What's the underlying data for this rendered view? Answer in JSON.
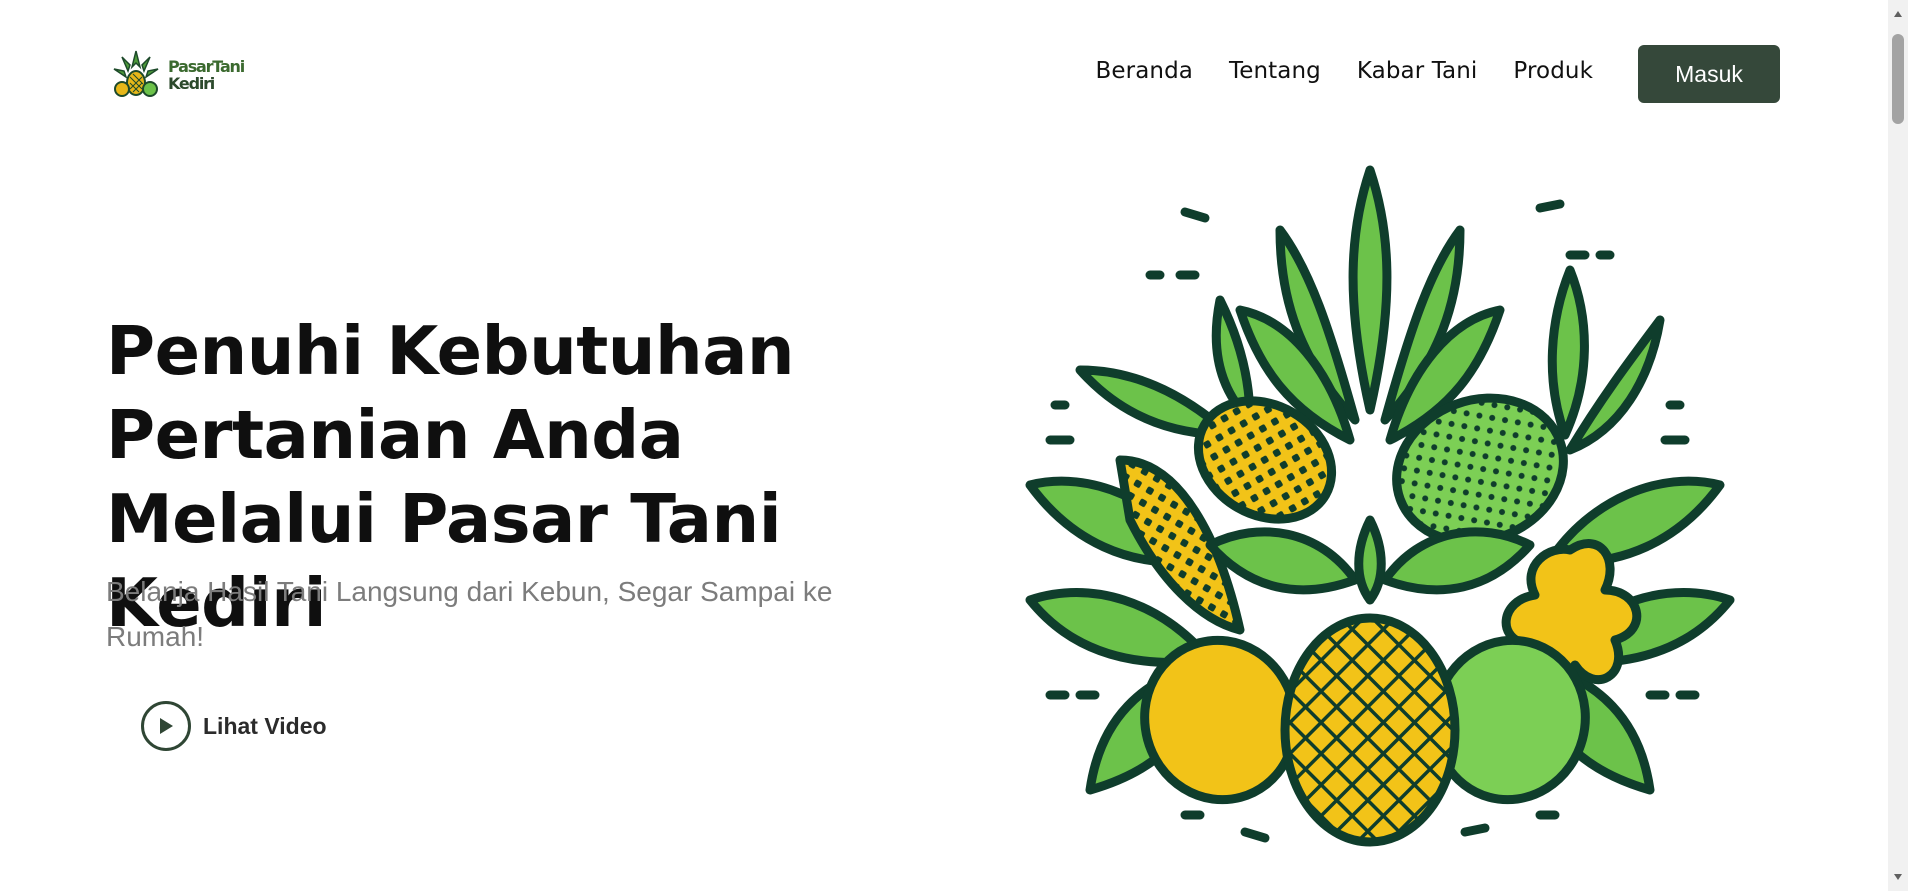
{
  "header": {
    "logo": {
      "line1": "PasarTani",
      "line2": "Kediri"
    },
    "nav": [
      "Beranda",
      "Tentang",
      "Kabar Tani",
      "Produk"
    ],
    "login_label": "Masuk"
  },
  "hero": {
    "title": "Penuhi Kebutuhan Pertanian Anda Melalui Pasar Tani Kediri",
    "subtitle": "Belanja Hasil Tani Langsung dari Kebun, Segar Sampai ke Rumah!",
    "video_label": "Lihat Video",
    "illustration": "fruit-bouquet-illustration"
  },
  "colors": {
    "primary": "#35483a",
    "outline": "#0f3d2c",
    "leaf_green": "#6cc24a",
    "fruit_yellow": "#f2c318",
    "subtitle_gray": "#7c7c7c"
  },
  "icons": [
    "logo-icon",
    "play-icon",
    "scroll-up-icon",
    "scroll-down-icon"
  ]
}
